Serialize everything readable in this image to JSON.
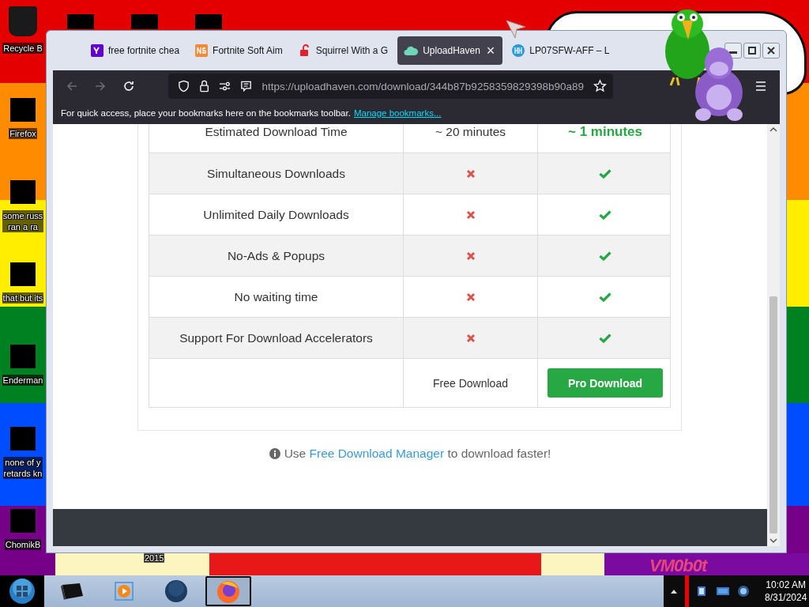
{
  "desktop_icons": [
    {
      "lines": [
        "Recycle B"
      ],
      "kind": "bin"
    },
    {
      "lines": [
        "Firefox"
      ],
      "kind": "blocked"
    },
    {
      "lines": [
        "some russ",
        "ran a ra"
      ],
      "kind": "blocked"
    },
    {
      "lines": [
        "that but its"
      ],
      "kind": "blocked"
    },
    {
      "lines": [
        "Enderman"
      ],
      "kind": "blocked"
    },
    {
      "lines": [
        "none of y",
        "retards kn"
      ],
      "kind": "blocked"
    },
    {
      "lines": [
        "ChomikB"
      ],
      "kind": "blocked"
    }
  ],
  "wallpaper": {
    "texts": [
      "2015",
      "VM0b0t"
    ]
  },
  "browser": {
    "tabs": [
      {
        "title": "free fortnite chea",
        "kind": "yahoo",
        "selected": false
      },
      {
        "title": "Fortnite Soft Aim",
        "kind": "ng",
        "selected": false
      },
      {
        "title": "Squirrel With a G",
        "kind": "lock",
        "selected": false
      },
      {
        "title": "UploadHaven",
        "kind": "cloud",
        "selected": true,
        "close": "×"
      },
      {
        "title": "LP07SFW-AFF – L",
        "kind": "hh",
        "selected": false
      }
    ],
    "back_disabled": true,
    "forward_disabled": true,
    "url": "https://uploadhaven.com/download/344b87b9258359829398b90a89",
    "bookmarks_bar": {
      "message": "For quick access, place your bookmarks here on the bookmarks toolbar.",
      "link": "Manage bookmarks..."
    },
    "comparison": [
      {
        "feature": "Estimated Download Time",
        "free": {
          "kind": "text",
          "text": "~ 20 minutes"
        },
        "pro": {
          "kind": "highlight",
          "text": "~ 1 minutes"
        }
      },
      {
        "feature": "Simultaneous Downloads",
        "free": {
          "kind": "cross"
        },
        "pro": {
          "kind": "check"
        }
      },
      {
        "feature": "Unlimited Daily Downloads",
        "free": {
          "kind": "cross"
        },
        "pro": {
          "kind": "check"
        }
      },
      {
        "feature": "No-Ads & Popups",
        "free": {
          "kind": "cross"
        },
        "pro": {
          "kind": "check"
        }
      },
      {
        "feature": "No waiting time",
        "free": {
          "kind": "cross"
        },
        "pro": {
          "kind": "check"
        }
      },
      {
        "feature": "Support For Download Accelerators",
        "free": {
          "kind": "cross"
        },
        "pro": {
          "kind": "check"
        }
      },
      {
        "free": {
          "kind": "text",
          "text": "Free Download"
        },
        "pro": {
          "kind": "button",
          "text": "Pro Download"
        }
      }
    ],
    "info": {
      "before": "Use ",
      "link": "Free Download Manager",
      "after": " to download faster!"
    }
  },
  "taskbar": {
    "items": [
      {
        "kind": "terminal",
        "selected": false
      },
      {
        "kind": "media",
        "selected": false
      },
      {
        "kind": "globe",
        "selected": false
      },
      {
        "kind": "firefox",
        "selected": true
      }
    ],
    "time": "10:02 AM",
    "date": "8/31/2024"
  }
}
